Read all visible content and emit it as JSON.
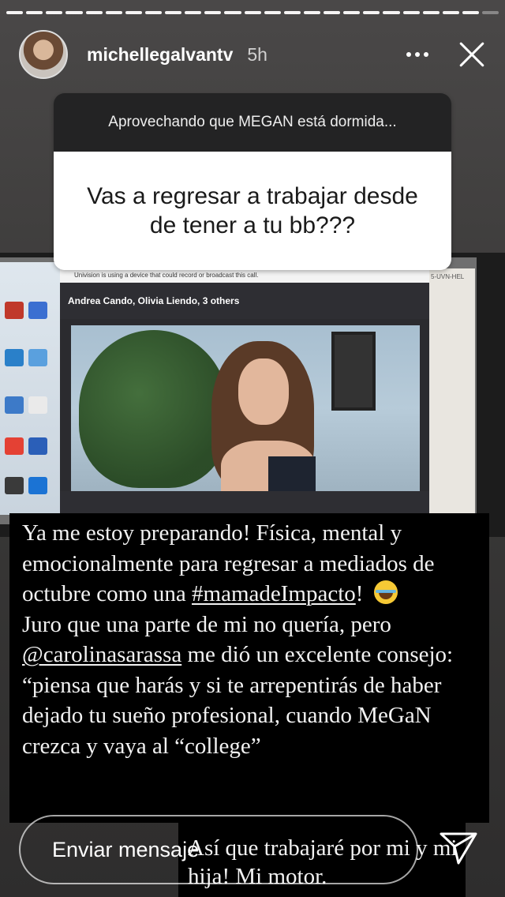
{
  "story": {
    "username": "michellegalvantv",
    "time": "5h",
    "progress_segments_total": 25,
    "progress_segments_done": 24
  },
  "question": {
    "header": "Aprovechando que MEGAN está dormida...",
    "text": "Vas a regresar a trabajar desde de tener a tu bb???"
  },
  "meeting": {
    "warning": "Univision is using a device that could record or broadcast this call.",
    "participants": "Andrea Cando, Olivia Liendo, 3 others",
    "right_text": "5-UVN-HEL"
  },
  "caption": {
    "line1": "Ya me estoy preparando! Física, mental y emocionalmente para regresar a mediados de octubre como una",
    "hashtag": "#mamadeImpacto",
    "after_hashtag": "!",
    "line2_a": "Juro que una parte de mi no quería, pero",
    "mention": "@carolinasarassa",
    "line2_b": "me dió un excelente consejo: “piensa que harás y si te arrepentirás de haber dejado tu sueño profesional, cuando MeGaN crezca y vaya al “college”",
    "tail": "Así que trabajaré por mi y mi hija! Mi motor."
  },
  "reply": {
    "placeholder": "Enviar mensaje"
  },
  "icons": {
    "more": "more-horizontal-icon",
    "close": "close-icon",
    "send": "send-paper-plane-icon",
    "emoji": "face-with-tears-of-joy-emoji"
  }
}
